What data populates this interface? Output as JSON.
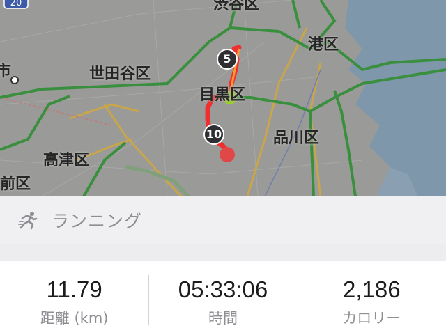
{
  "map": {
    "labels": {
      "setagaya": "世田谷区",
      "meguro": "目黒区",
      "minato": "港区",
      "shinagawa": "品川区",
      "takatsu": "高津区",
      "nakahara": "前区",
      "partial_top": "渋谷区",
      "partial_left": "市",
      "highway_sign": "20"
    },
    "km_markers": [
      "5",
      "10"
    ],
    "colors": {
      "route": "#f03030",
      "start_dot": "#9ccc2a",
      "end_dot": "#e04848",
      "road_green": "#3a8f3e",
      "road_orange": "#c9a64a",
      "water": "#7e97ab"
    }
  },
  "activity": {
    "icon": "runner-icon",
    "label": "ランニング"
  },
  "stats": [
    {
      "value": "11.79",
      "label": "距離 (km)"
    },
    {
      "value": "05:33:06",
      "label": "時間"
    },
    {
      "value": "2,186",
      "label": "カロリー"
    }
  ]
}
